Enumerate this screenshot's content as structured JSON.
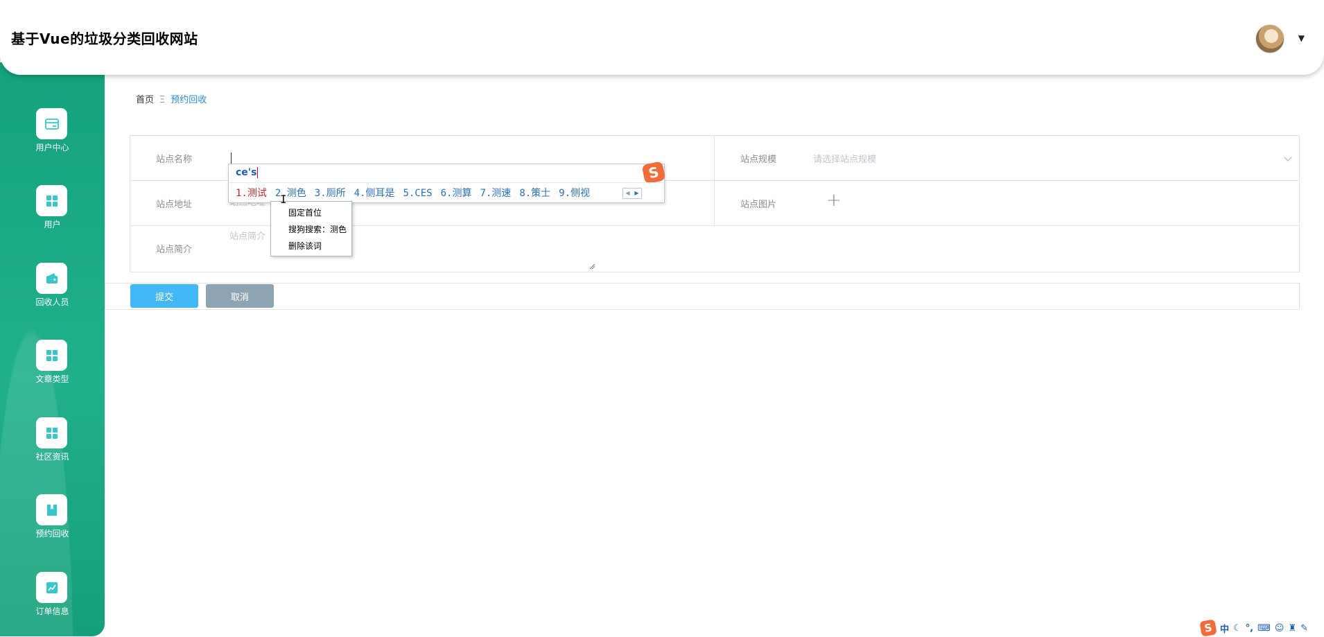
{
  "header": {
    "title": "基于Vue的垃圾分类回收网站"
  },
  "sidebar": {
    "items": [
      {
        "label": "用户中心",
        "icon": "card-icon"
      },
      {
        "label": "用户",
        "icon": "grid-icon"
      },
      {
        "label": "回收人员",
        "icon": "wallet-icon"
      },
      {
        "label": "文章类型",
        "icon": "grid-icon"
      },
      {
        "label": "社区资讯",
        "icon": "grid-icon"
      },
      {
        "label": "预约回收",
        "icon": "book-icon"
      },
      {
        "label": "订单信息",
        "icon": "chart-icon"
      }
    ]
  },
  "breadcrumb": {
    "home": "首页",
    "separator": "Ξ",
    "current": "预约回收"
  },
  "form": {
    "site_name_label": "站点名称",
    "site_name_value": "",
    "site_scale_label": "站点规模",
    "site_scale_placeholder": "请选择站点规模",
    "site_address_label": "站点地址",
    "site_address_placeholder": "站点地址",
    "site_image_label": "站点图片",
    "site_intro_label": "站点简介",
    "site_intro_placeholder": "站点简介"
  },
  "buttons": {
    "submit": "提交",
    "cancel": "取消"
  },
  "ime": {
    "composition": "ce's",
    "candidates": [
      "1.测试",
      "2.测色",
      "3.厕所",
      "4.侧耳是",
      "5.CES",
      "6.测算",
      "7.测速",
      "8.策士",
      "9.侧视"
    ],
    "context_menu": [
      "固定首位",
      "搜狗搜索：测色",
      "删除该词"
    ],
    "status_bar": [
      "中",
      "°,"
    ]
  },
  "colors": {
    "sidebar_green": "#1aa981",
    "submit_blue": "#43b8f7",
    "cancel_gray": "#8fa4b3",
    "link_blue": "#2a8ad4",
    "sogou_orange": "#f26b3a"
  }
}
